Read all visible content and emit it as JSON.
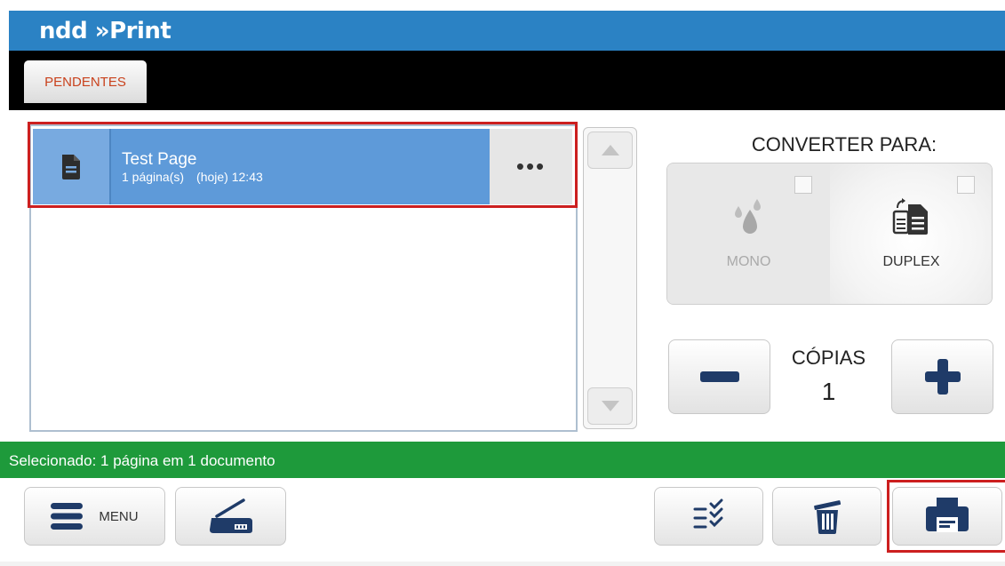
{
  "app": {
    "logo_text": "ndd »Print"
  },
  "tabs": [
    {
      "label": "PENDENTES",
      "active": true
    }
  ],
  "jobs": [
    {
      "title": "Test Page",
      "pages": "1 página(s)",
      "time": "(hoje) 12:43",
      "selected": true,
      "more_label": "•••"
    }
  ],
  "convert": {
    "title": "CONVERTER PARA:",
    "options": [
      {
        "label": "MONO",
        "checked": false,
        "enabled": false,
        "icon": "ink-drops-icon"
      },
      {
        "label": "DUPLEX",
        "checked": false,
        "enabled": true,
        "icon": "duplex-pages-icon"
      }
    ]
  },
  "copies": {
    "label": "CÓPIAS",
    "value": "1"
  },
  "status": {
    "text": "Selecionado: 1 página em 1 documento"
  },
  "bottom": {
    "menu_label": "MENU"
  },
  "colors": {
    "header": "#2b82c4",
    "selected_row": "#5e9ad9",
    "status_bar": "#1e9a3b",
    "highlight": "#cc1f1f",
    "tab_text": "#c9421d"
  }
}
